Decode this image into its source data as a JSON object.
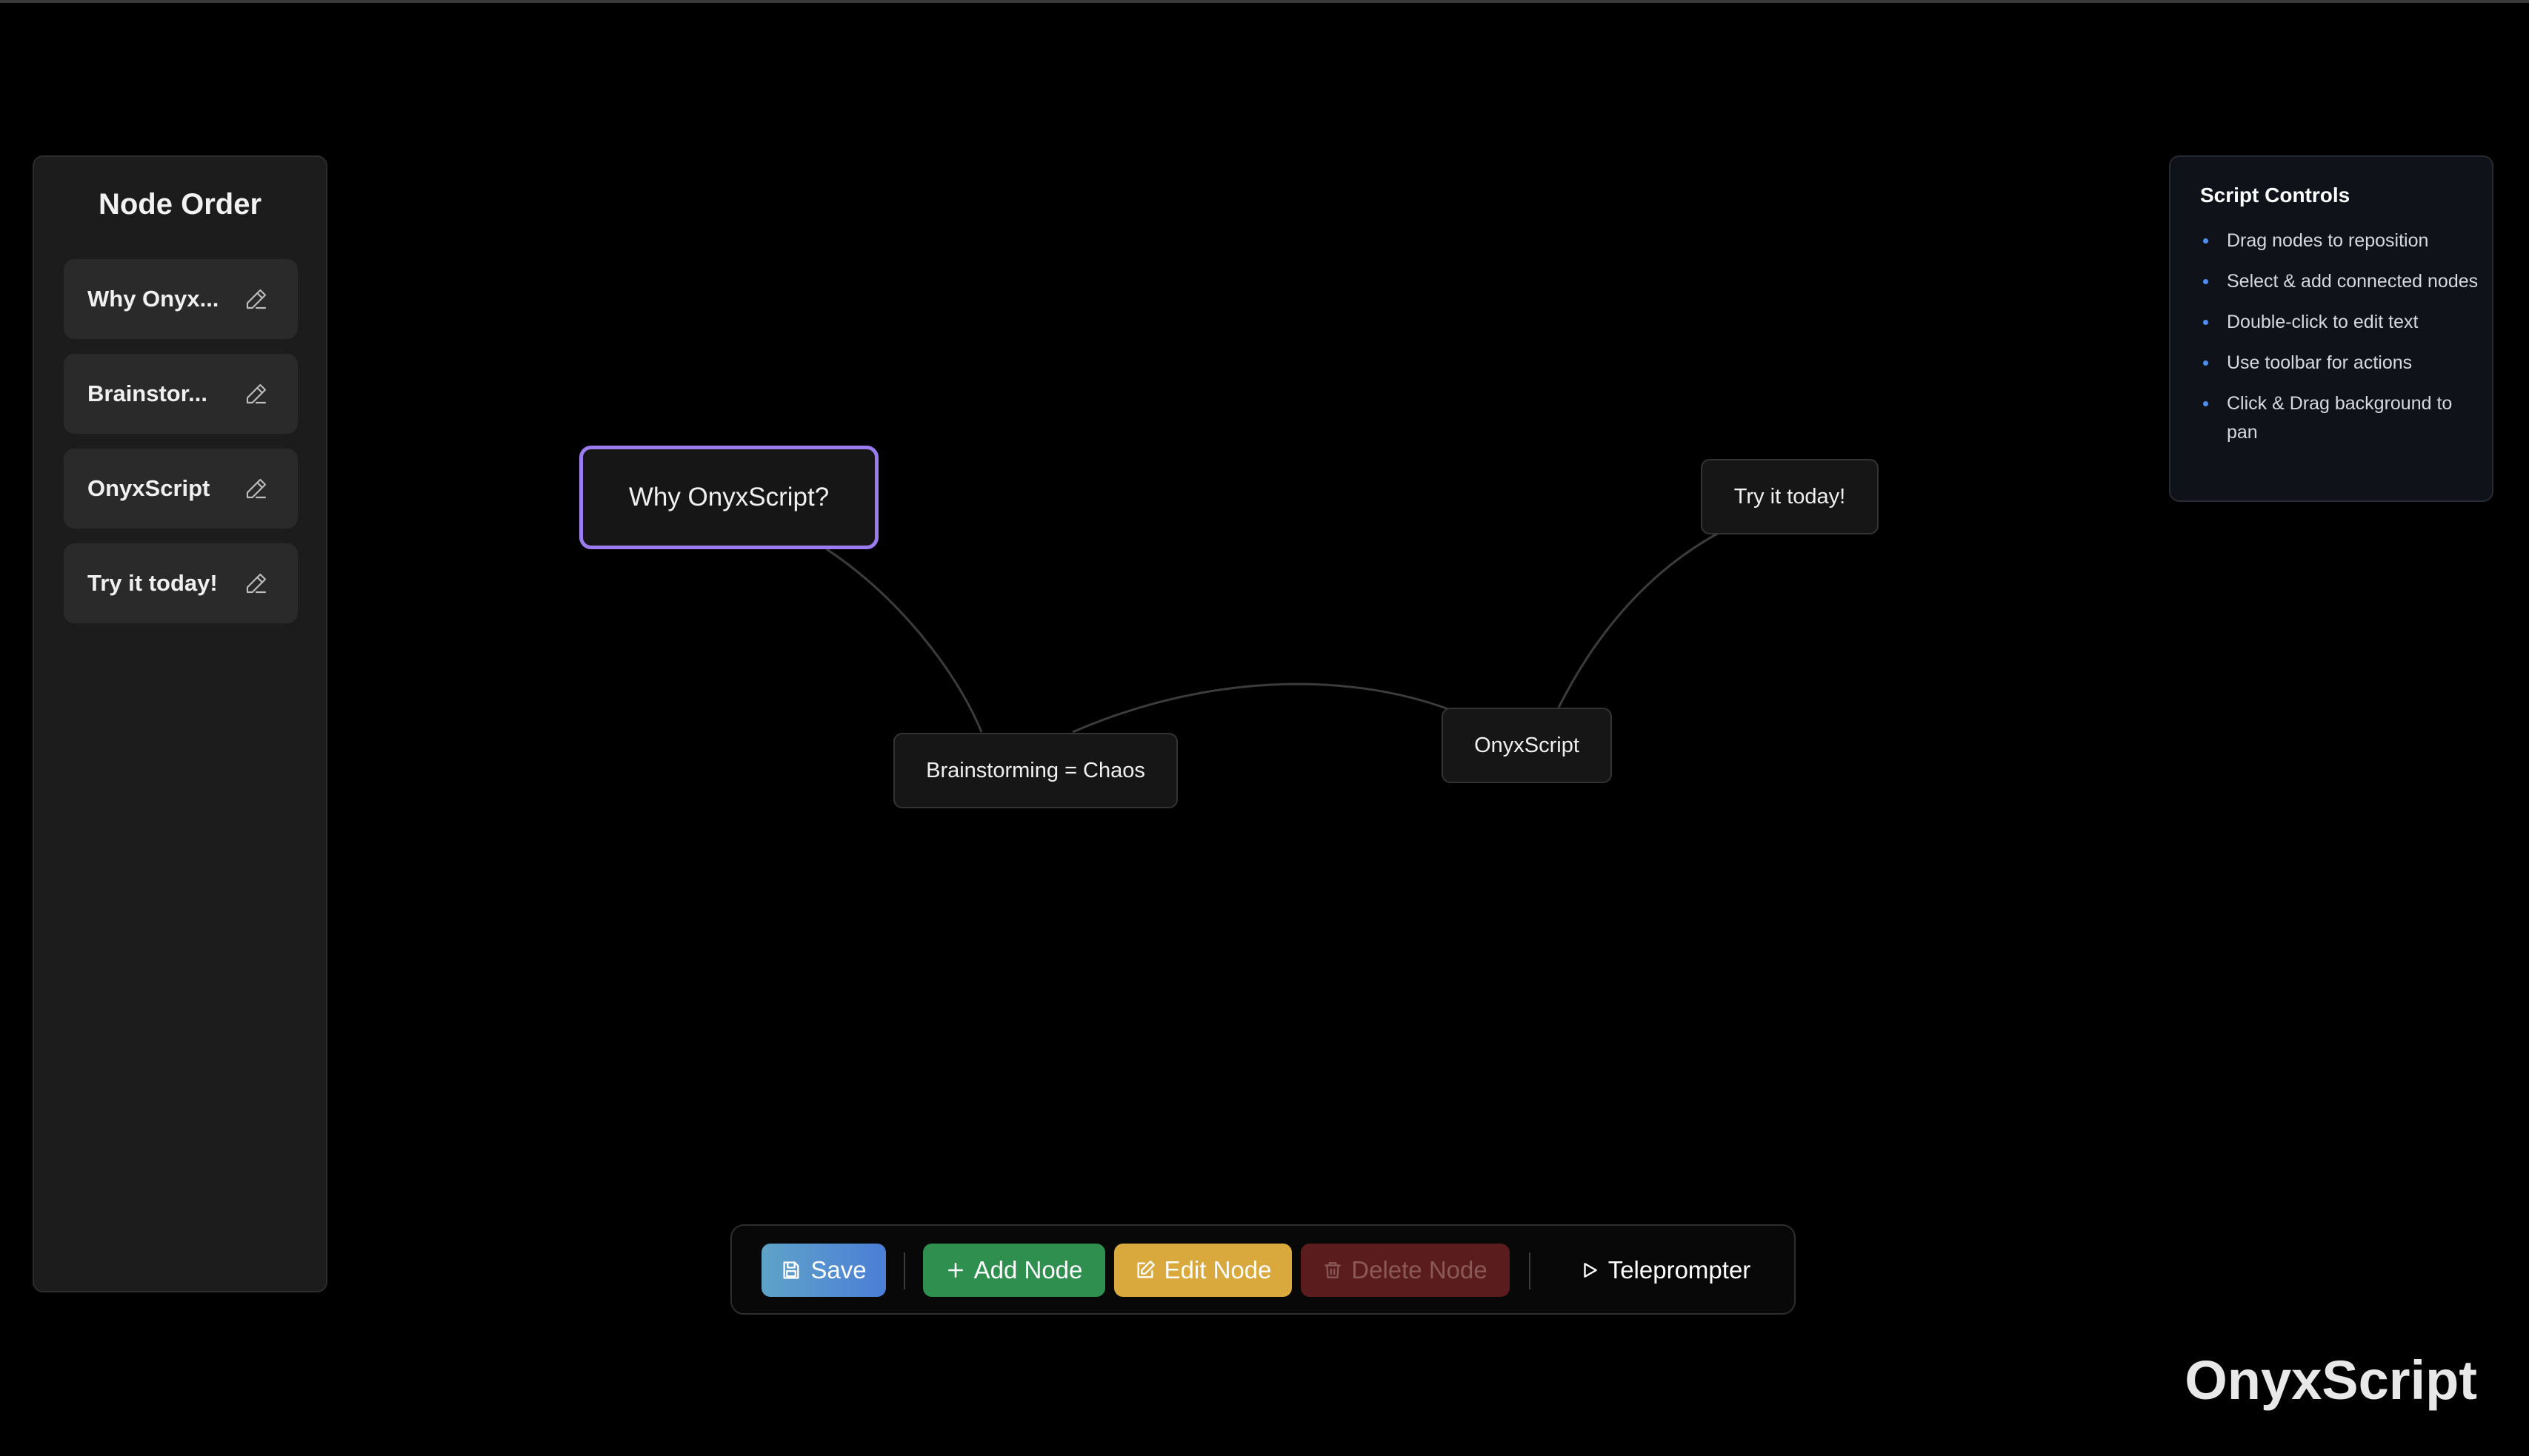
{
  "sidebar": {
    "title": "Node Order",
    "items": [
      {
        "label": "Why Onyx..."
      },
      {
        "label": "Brainstor..."
      },
      {
        "label": "OnyxScript"
      },
      {
        "label": "Try it today!"
      }
    ]
  },
  "canvas": {
    "nodes": [
      {
        "label": "Why OnyxScript?",
        "selected": true
      },
      {
        "label": "Brainstorming = Chaos",
        "selected": false
      },
      {
        "label": "OnyxScript",
        "selected": false
      },
      {
        "label": "Try it today!",
        "selected": false
      }
    ]
  },
  "controls": {
    "title": "Script Controls",
    "items": [
      "Drag nodes to reposition",
      "Select & add connected nodes",
      "Double-click to edit text",
      "Use toolbar for actions",
      "Click & Drag background to pan"
    ]
  },
  "toolbar": {
    "save_label": "Save",
    "add_label": "Add Node",
    "edit_label": "Edit Node",
    "delete_label": "Delete Node",
    "teleprompter_label": "Teleprompter"
  },
  "brand": "OnyxScript",
  "colors": {
    "accent_selected": "#9b7cf0",
    "bullet": "#4d8ff0",
    "save": "#4b7ed6",
    "add": "#2f8f4e",
    "edit": "#d9a93d",
    "delete": "#5a1c1c"
  },
  "icons": {
    "order_edit": "pencil-icon",
    "save": "floppy-disk-icon",
    "add": "plus-icon",
    "edit": "edit-square-icon",
    "delete": "trash-icon",
    "teleprompter": "play-icon"
  }
}
